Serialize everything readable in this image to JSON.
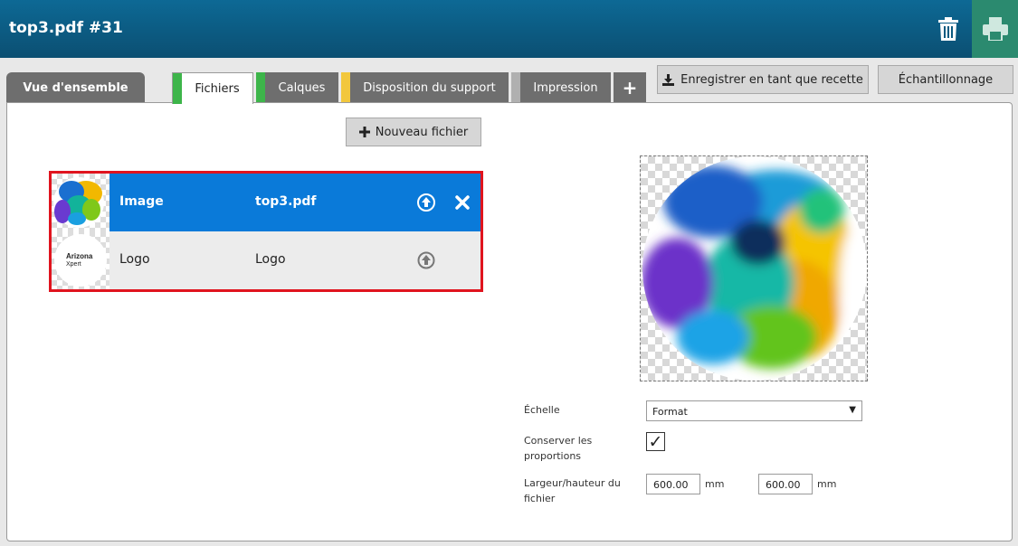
{
  "header": {
    "title": "top3.pdf #31"
  },
  "tabs": {
    "overview": "Vue d'ensemble",
    "files": "Fichiers",
    "layers": "Calques",
    "layout": "Disposition du support",
    "print": "Impression",
    "add": "+"
  },
  "tab_colors": {
    "files": "#3db54a",
    "layers": "#3db54a",
    "layout": "#f2c73c",
    "print": "#b0b0b0"
  },
  "toolbar": {
    "save_recipe": "Enregistrer en tant que recette",
    "sampling": "Échantillonnage",
    "new_file": "Nouveau fichier"
  },
  "files": [
    {
      "name": "Image",
      "source": "top3.pdf",
      "selected": true
    },
    {
      "name": "Logo",
      "source": "Logo",
      "selected": false,
      "thumb_text_1": "Arizona",
      "thumb_text_2": "Xpert"
    }
  ],
  "form": {
    "scale_label": "Échelle",
    "scale_value": "Format",
    "keep_ratio_label_1": "Conserver les",
    "keep_ratio_label_2": "proportions",
    "keep_ratio_checked": "✓",
    "size_label_1": "Largeur/hauteur du",
    "size_label_2": "fichier",
    "width_value": "600.00",
    "height_value": "600.00",
    "unit": "mm"
  },
  "colors": {
    "header": "#0b5a80",
    "selected_row": "#0a7ad9",
    "highlight_border": "#e0141e",
    "print_button": "#2b8a6f"
  }
}
